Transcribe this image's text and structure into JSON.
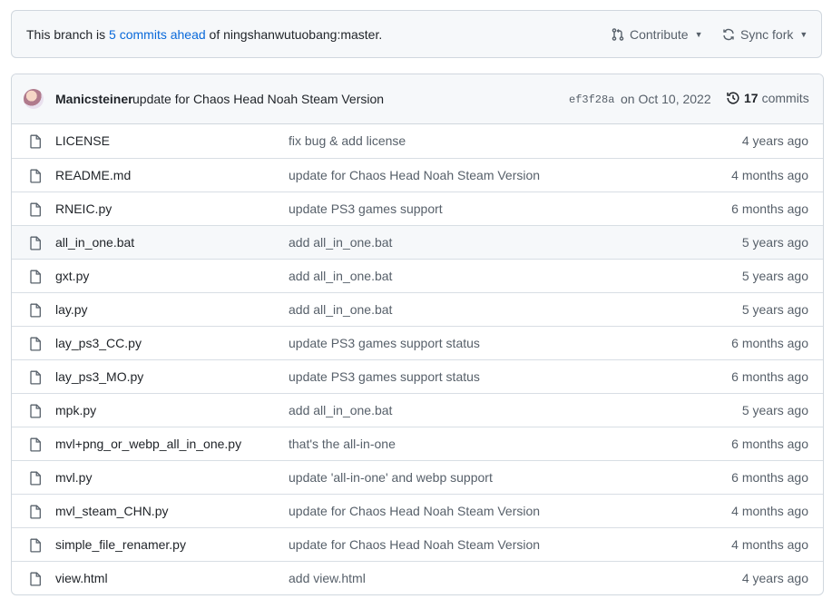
{
  "branch_bar": {
    "prefix": "This branch is ",
    "ahead_link": "5 commits ahead",
    "suffix": " of ningshanwutuobang:master.",
    "contribute_label": "Contribute",
    "sync_fork_label": "Sync fork"
  },
  "latest_commit": {
    "author": "Manicsteiner",
    "message": "update for Chaos Head Noah Steam Version",
    "sha": "ef3f28a",
    "date": "on Oct 10, 2022",
    "commit_count": "17",
    "commits_label": "commits"
  },
  "files": [
    {
      "name": "LICENSE",
      "message": "fix bug & add license",
      "age": "4 years ago"
    },
    {
      "name": "README.md",
      "message": "update for Chaos Head Noah Steam Version",
      "age": "4 months ago"
    },
    {
      "name": "RNEIC.py",
      "message": "update PS3 games support",
      "age": "6 months ago"
    },
    {
      "name": "all_in_one.bat",
      "message": "add all_in_one.bat",
      "age": "5 years ago"
    },
    {
      "name": "gxt.py",
      "message": "add all_in_one.bat",
      "age": "5 years ago"
    },
    {
      "name": "lay.py",
      "message": "add all_in_one.bat",
      "age": "5 years ago"
    },
    {
      "name": "lay_ps3_CC.py",
      "message": "update PS3 games support status",
      "age": "6 months ago"
    },
    {
      "name": "lay_ps3_MO.py",
      "message": "update PS3 games support status",
      "age": "6 months ago"
    },
    {
      "name": "mpk.py",
      "message": "add all_in_one.bat",
      "age": "5 years ago"
    },
    {
      "name": "mvl+png_or_webp_all_in_one.py",
      "message": "that's the all-in-one",
      "age": "6 months ago"
    },
    {
      "name": "mvl.py",
      "message": "update 'all-in-one' and webp support",
      "age": "6 months ago"
    },
    {
      "name": "mvl_steam_CHN.py",
      "message": "update for Chaos Head Noah Steam Version",
      "age": "4 months ago"
    },
    {
      "name": "simple_file_renamer.py",
      "message": "update for Chaos Head Noah Steam Version",
      "age": "4 months ago"
    },
    {
      "name": "view.html",
      "message": "add view.html",
      "age": "4 years ago"
    }
  ],
  "colors": {
    "link": "#0969da",
    "muted": "#57606a",
    "border": "#d0d7de",
    "header_bg": "#f6f8fa"
  },
  "icons": [
    "git-pull-request-icon",
    "sync-icon",
    "history-icon",
    "file-icon",
    "avatar"
  ]
}
